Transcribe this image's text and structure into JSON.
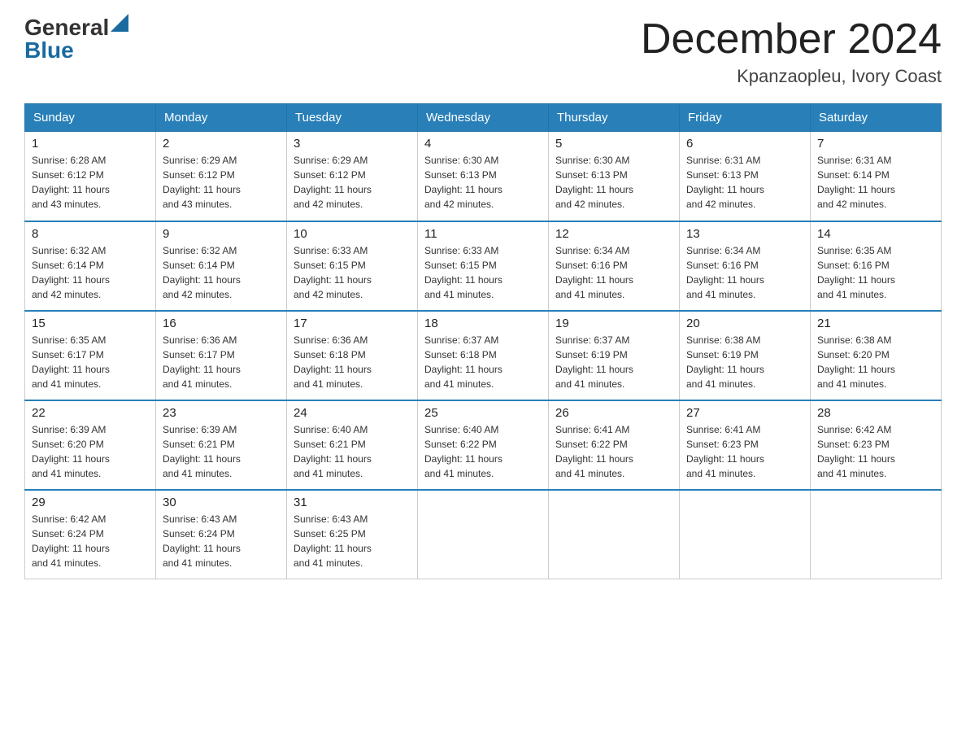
{
  "header": {
    "logo_general": "General",
    "logo_blue": "Blue",
    "month_title": "December 2024",
    "location": "Kpanzaopleu, Ivory Coast"
  },
  "days_of_week": [
    "Sunday",
    "Monday",
    "Tuesday",
    "Wednesday",
    "Thursday",
    "Friday",
    "Saturday"
  ],
  "weeks": [
    [
      {
        "day": "1",
        "sunrise": "6:28 AM",
        "sunset": "6:12 PM",
        "daylight": "11 hours and 43 minutes."
      },
      {
        "day": "2",
        "sunrise": "6:29 AM",
        "sunset": "6:12 PM",
        "daylight": "11 hours and 43 minutes."
      },
      {
        "day": "3",
        "sunrise": "6:29 AM",
        "sunset": "6:12 PM",
        "daylight": "11 hours and 42 minutes."
      },
      {
        "day": "4",
        "sunrise": "6:30 AM",
        "sunset": "6:13 PM",
        "daylight": "11 hours and 42 minutes."
      },
      {
        "day": "5",
        "sunrise": "6:30 AM",
        "sunset": "6:13 PM",
        "daylight": "11 hours and 42 minutes."
      },
      {
        "day": "6",
        "sunrise": "6:31 AM",
        "sunset": "6:13 PM",
        "daylight": "11 hours and 42 minutes."
      },
      {
        "day": "7",
        "sunrise": "6:31 AM",
        "sunset": "6:14 PM",
        "daylight": "11 hours and 42 minutes."
      }
    ],
    [
      {
        "day": "8",
        "sunrise": "6:32 AM",
        "sunset": "6:14 PM",
        "daylight": "11 hours and 42 minutes."
      },
      {
        "day": "9",
        "sunrise": "6:32 AM",
        "sunset": "6:14 PM",
        "daylight": "11 hours and 42 minutes."
      },
      {
        "day": "10",
        "sunrise": "6:33 AM",
        "sunset": "6:15 PM",
        "daylight": "11 hours and 42 minutes."
      },
      {
        "day": "11",
        "sunrise": "6:33 AM",
        "sunset": "6:15 PM",
        "daylight": "11 hours and 41 minutes."
      },
      {
        "day": "12",
        "sunrise": "6:34 AM",
        "sunset": "6:16 PM",
        "daylight": "11 hours and 41 minutes."
      },
      {
        "day": "13",
        "sunrise": "6:34 AM",
        "sunset": "6:16 PM",
        "daylight": "11 hours and 41 minutes."
      },
      {
        "day": "14",
        "sunrise": "6:35 AM",
        "sunset": "6:16 PM",
        "daylight": "11 hours and 41 minutes."
      }
    ],
    [
      {
        "day": "15",
        "sunrise": "6:35 AM",
        "sunset": "6:17 PM",
        "daylight": "11 hours and 41 minutes."
      },
      {
        "day": "16",
        "sunrise": "6:36 AM",
        "sunset": "6:17 PM",
        "daylight": "11 hours and 41 minutes."
      },
      {
        "day": "17",
        "sunrise": "6:36 AM",
        "sunset": "6:18 PM",
        "daylight": "11 hours and 41 minutes."
      },
      {
        "day": "18",
        "sunrise": "6:37 AM",
        "sunset": "6:18 PM",
        "daylight": "11 hours and 41 minutes."
      },
      {
        "day": "19",
        "sunrise": "6:37 AM",
        "sunset": "6:19 PM",
        "daylight": "11 hours and 41 minutes."
      },
      {
        "day": "20",
        "sunrise": "6:38 AM",
        "sunset": "6:19 PM",
        "daylight": "11 hours and 41 minutes."
      },
      {
        "day": "21",
        "sunrise": "6:38 AM",
        "sunset": "6:20 PM",
        "daylight": "11 hours and 41 minutes."
      }
    ],
    [
      {
        "day": "22",
        "sunrise": "6:39 AM",
        "sunset": "6:20 PM",
        "daylight": "11 hours and 41 minutes."
      },
      {
        "day": "23",
        "sunrise": "6:39 AM",
        "sunset": "6:21 PM",
        "daylight": "11 hours and 41 minutes."
      },
      {
        "day": "24",
        "sunrise": "6:40 AM",
        "sunset": "6:21 PM",
        "daylight": "11 hours and 41 minutes."
      },
      {
        "day": "25",
        "sunrise": "6:40 AM",
        "sunset": "6:22 PM",
        "daylight": "11 hours and 41 minutes."
      },
      {
        "day": "26",
        "sunrise": "6:41 AM",
        "sunset": "6:22 PM",
        "daylight": "11 hours and 41 minutes."
      },
      {
        "day": "27",
        "sunrise": "6:41 AM",
        "sunset": "6:23 PM",
        "daylight": "11 hours and 41 minutes."
      },
      {
        "day": "28",
        "sunrise": "6:42 AM",
        "sunset": "6:23 PM",
        "daylight": "11 hours and 41 minutes."
      }
    ],
    [
      {
        "day": "29",
        "sunrise": "6:42 AM",
        "sunset": "6:24 PM",
        "daylight": "11 hours and 41 minutes."
      },
      {
        "day": "30",
        "sunrise": "6:43 AM",
        "sunset": "6:24 PM",
        "daylight": "11 hours and 41 minutes."
      },
      {
        "day": "31",
        "sunrise": "6:43 AM",
        "sunset": "6:25 PM",
        "daylight": "11 hours and 41 minutes."
      },
      null,
      null,
      null,
      null
    ]
  ],
  "labels": {
    "sunrise": "Sunrise:",
    "sunset": "Sunset:",
    "daylight": "Daylight:"
  }
}
